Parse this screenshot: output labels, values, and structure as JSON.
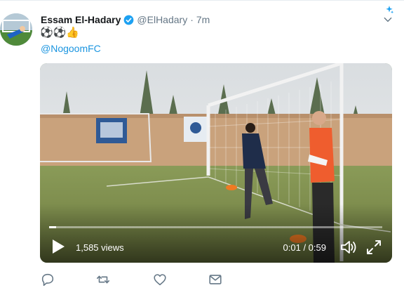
{
  "tweet": {
    "author_name": "Essam El-Hadary",
    "handle": "@ElHadary",
    "separator": "·",
    "time": "7m",
    "emojis": [
      "⚽",
      "⚽",
      "👍"
    ],
    "mention": "@NogoomFC",
    "verified": true
  },
  "video": {
    "views": "1,585 views",
    "timecode": "0:01 / 0:59",
    "progress": 0.02,
    "controls": [
      "play-icon",
      "volume-icon",
      "fullscreen-icon"
    ]
  },
  "actions": [
    "reply-icon",
    "retweet-icon",
    "like-icon",
    "dm-icon"
  ],
  "colors": {
    "link": "#1b95e0",
    "muted": "#657786",
    "icon": "#657786",
    "verified": "#1da1f2"
  }
}
